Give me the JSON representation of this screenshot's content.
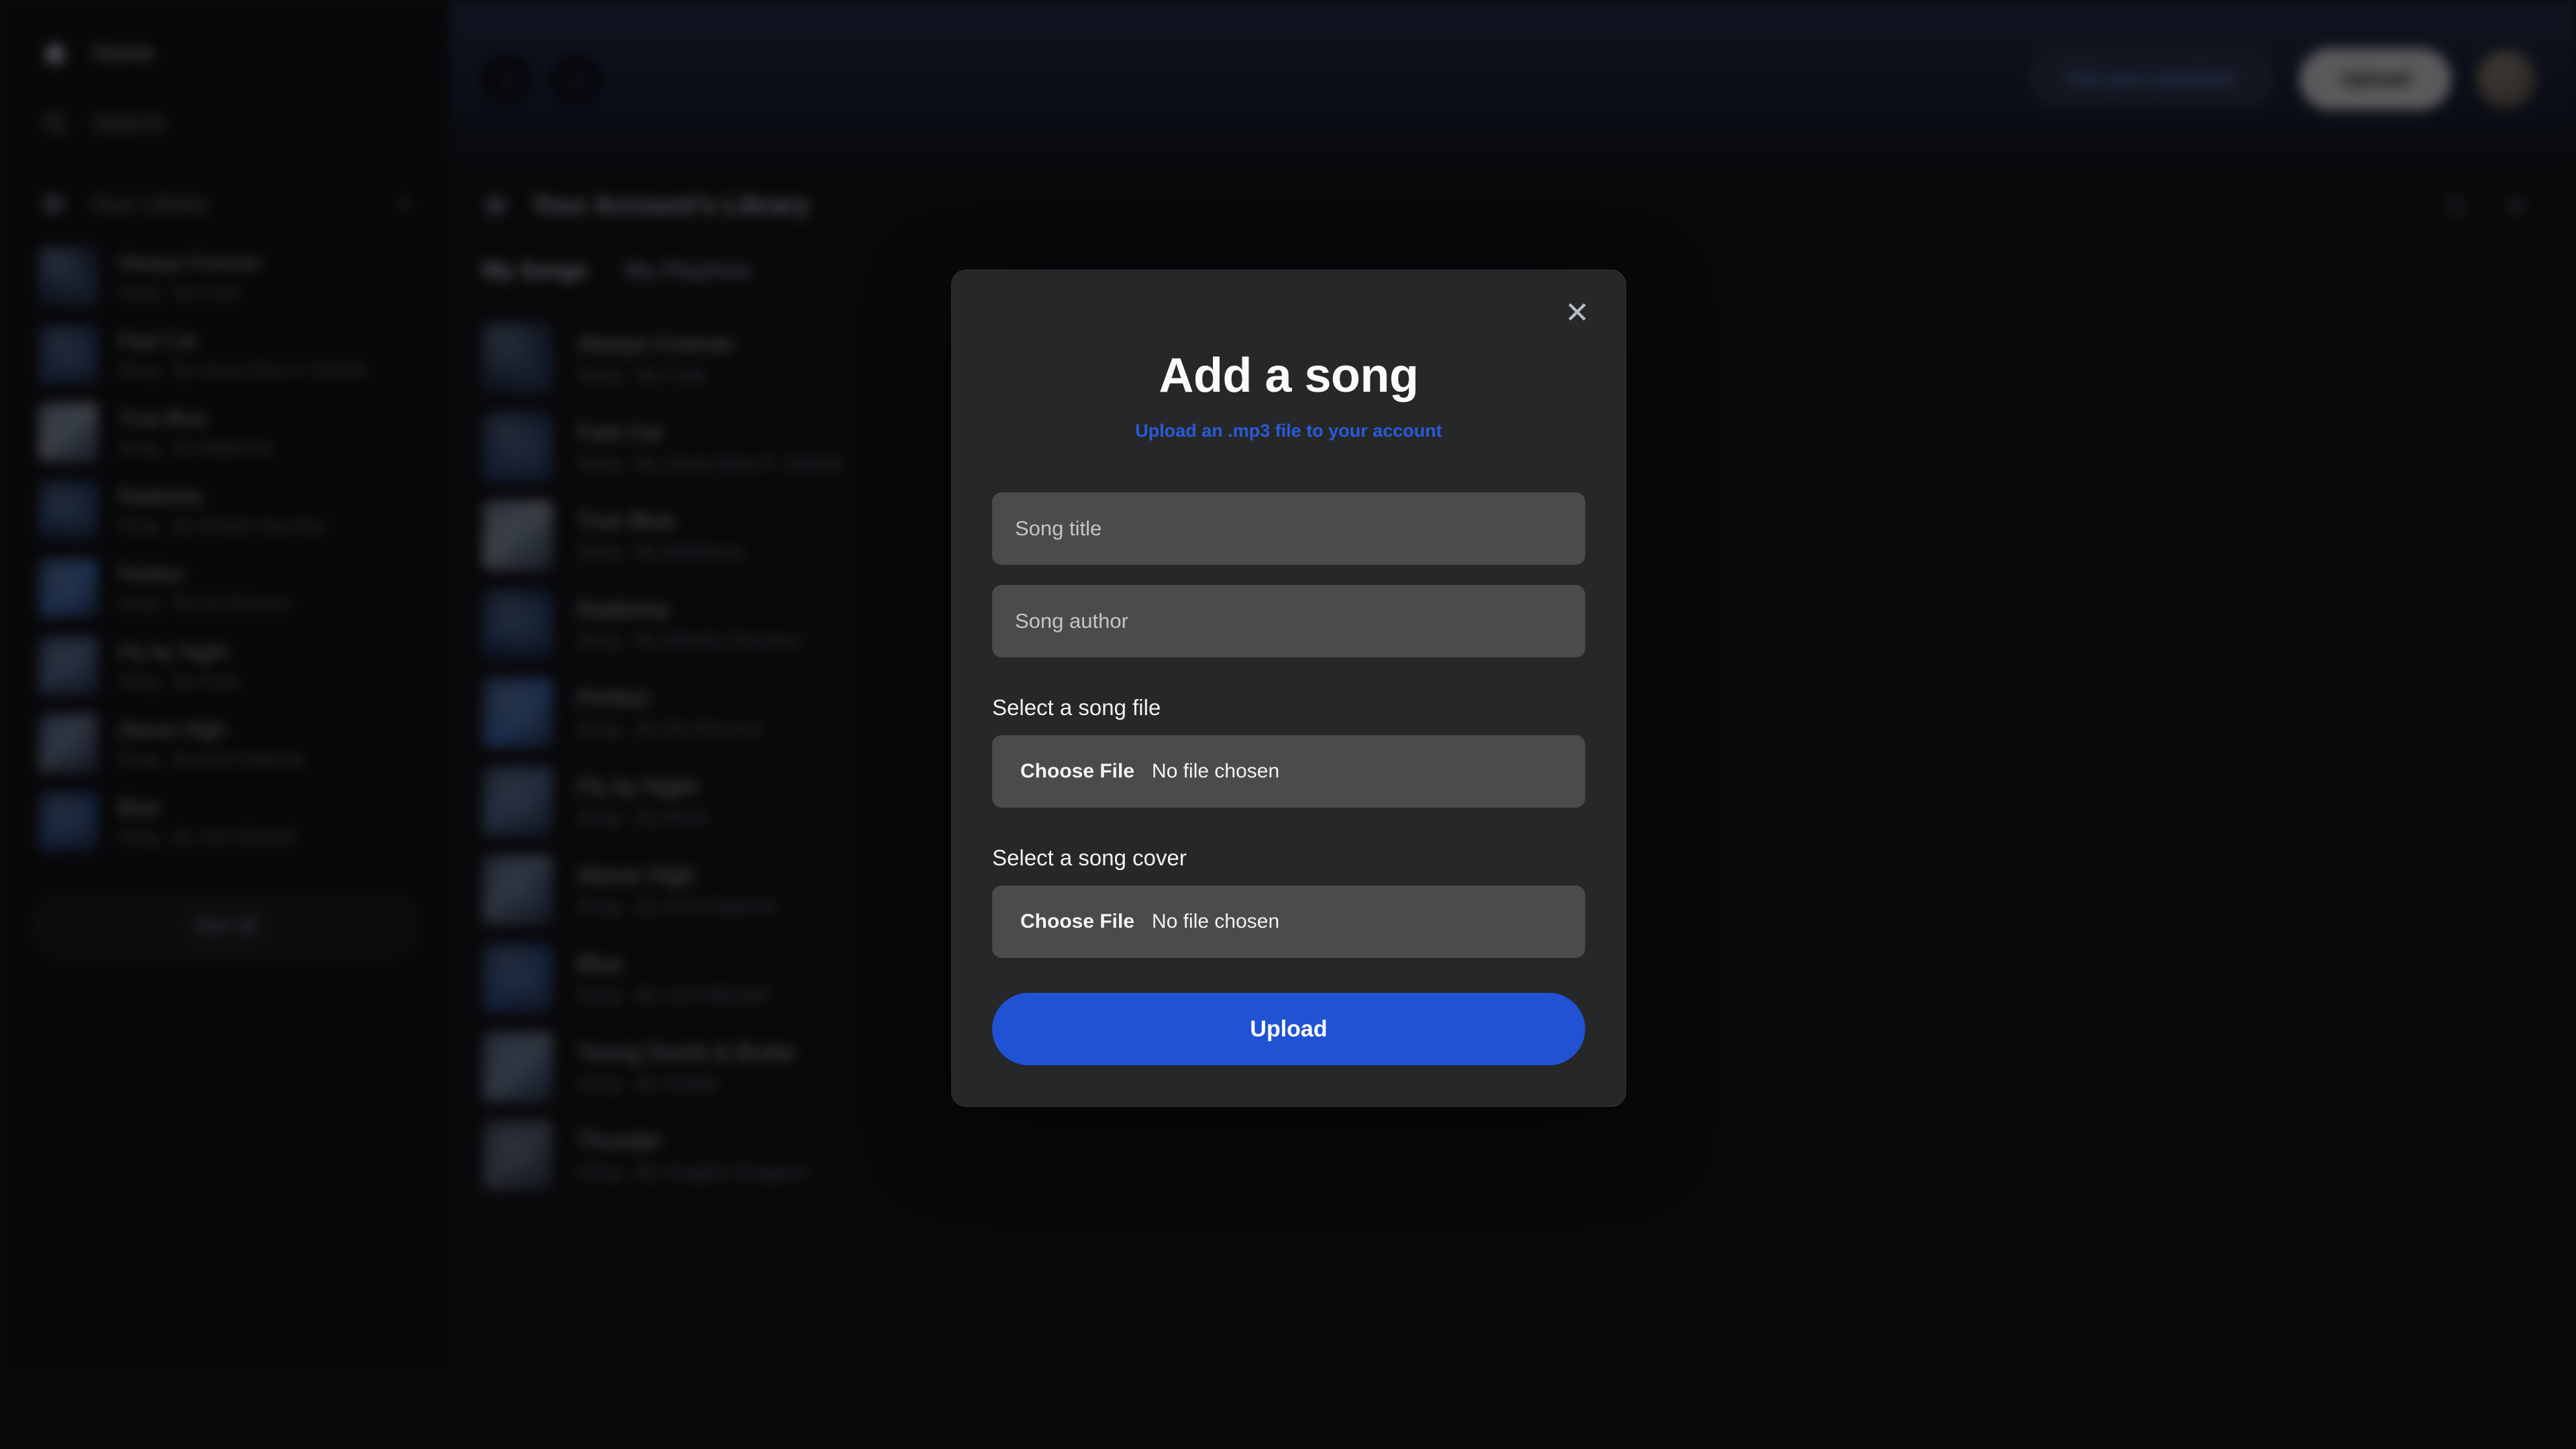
{
  "sidebar": {
    "nav": [
      {
        "label": "Home",
        "icon": "home-icon",
        "active": true
      },
      {
        "label": "Search",
        "icon": "search-icon",
        "active": false
      }
    ],
    "library": {
      "label": "Your Library",
      "icon": "library-icon",
      "add_icon": "plus-icon"
    },
    "songs": [
      {
        "title": "Always Forever",
        "subtitle": "Song · By Cults"
      },
      {
        "title": "Fast Car",
        "subtitle": "Song · By Jonas Blue ft. Dakota"
      },
      {
        "title": "True Blue",
        "subtitle": "Song · By Madonna"
      },
      {
        "title": "Radioma",
        "subtitle": "Song · By Alfredo Sanchez"
      },
      {
        "title": "Perfect",
        "subtitle": "Song · By Ed Sheeran"
      },
      {
        "title": "Fly by Night",
        "subtitle": "Song · By Rush"
      },
      {
        "title": "Above High",
        "subtitle": "Song · By Ariel Daphnia"
      },
      {
        "title": "Blue",
        "subtitle": "Song · By Joni Mitchell"
      }
    ],
    "see_all_label": "See all"
  },
  "topbar": {
    "back_icon": "chevron-left-icon",
    "forward_icon": "chevron-right-icon",
    "premium_label": "Get your premium",
    "upload_label": "Upload",
    "avatar_icon": "avatar"
  },
  "main": {
    "library_heading": "Your Account's Library",
    "library_icon": "library-icon",
    "actions": [
      {
        "icon": "search-icon"
      },
      {
        "icon": "list-view-icon"
      }
    ],
    "tabs": [
      {
        "label": "My Songs",
        "active": true
      },
      {
        "label": "My Playlists",
        "active": false
      }
    ],
    "songs": [
      {
        "title": "Always Forever",
        "subtitle": "Song · By Cults"
      },
      {
        "title": "Fast Car",
        "subtitle": "Song · By Jonas Blue ft. Dakota"
      },
      {
        "title": "True Blue",
        "subtitle": "Song · By Madonna"
      },
      {
        "title": "Radioma",
        "subtitle": "Song · By Alfredo Sanchez"
      },
      {
        "title": "Perfect",
        "subtitle": "Song · By Ed Sheeran"
      },
      {
        "title": "Fly by Night",
        "subtitle": "Song · By Rush"
      },
      {
        "title": "Above High",
        "subtitle": "Song · By Ariel Daphnia"
      },
      {
        "title": "Blue",
        "subtitle": "Song · By Joni Mitchell"
      },
      {
        "title": "Young Dumb & Broke",
        "subtitle": "Song · By Khalid"
      },
      {
        "title": "Thunder",
        "subtitle": "Song · By Imagine Dragons"
      }
    ]
  },
  "modal": {
    "close_icon": "close-icon",
    "title": "Add a song",
    "subtitle": "Upload an .mp3 file to your account",
    "song_title_placeholder": "Song title",
    "song_title_value": "",
    "song_author_placeholder": "Song author",
    "song_author_value": "",
    "song_file_label": "Select a song file",
    "song_file_button": "Choose File",
    "song_file_status": "No file chosen",
    "song_cover_label": "Select a song cover",
    "song_cover_button": "Choose File",
    "song_cover_status": "No file chosen",
    "submit_label": "Upload"
  },
  "colors": {
    "accent_blue": "#2152d4",
    "link_blue": "#2a5bd7",
    "modal_bg": "#262729",
    "field_bg": "#4b4b4d",
    "app_bg": "#111114"
  }
}
